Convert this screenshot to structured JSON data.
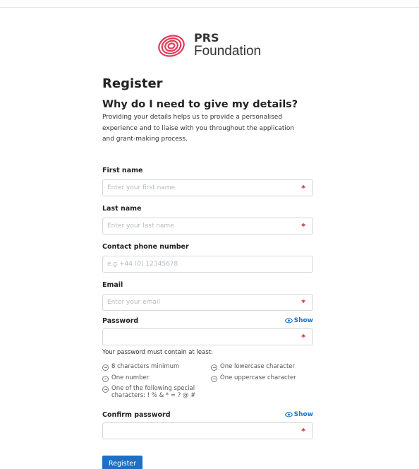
{
  "brand": {
    "line1": "PRS",
    "line2": "Foundation",
    "logo_color": "#e23b58"
  },
  "form": {
    "title": "Register",
    "subtitle": "Why do I need to give my details?",
    "intro": "Providing your details helps us to provide a personalised experience and to liaise with you throughout the application and grant-making process."
  },
  "fields": {
    "first_name": {
      "label": "First name",
      "placeholder": "Enter your first name",
      "required_mark": "*"
    },
    "last_name": {
      "label": "Last name",
      "placeholder": "Enter your last name",
      "required_mark": "*"
    },
    "phone": {
      "label": "Contact phone number",
      "placeholder": "e.g +44 (0) 12345678"
    },
    "email": {
      "label": "Email",
      "placeholder": "Enter your email",
      "required_mark": "*"
    },
    "password": {
      "label": "Password",
      "show_label": "Show",
      "required_mark": "*"
    },
    "confirm_password": {
      "label": "Confirm password",
      "show_label": "Show",
      "required_mark": "*"
    }
  },
  "password_rules": {
    "heading": "Your password must contain at least:",
    "rules": [
      "8 characters minimum",
      "One lowercase character",
      "One number",
      "One uppercase character",
      "One of the following special characters: ! % & * = ? @ #"
    ]
  },
  "actions": {
    "register_label": "Register"
  },
  "colors": {
    "accent": "#1f6fc4",
    "required": "#d21c1c"
  }
}
